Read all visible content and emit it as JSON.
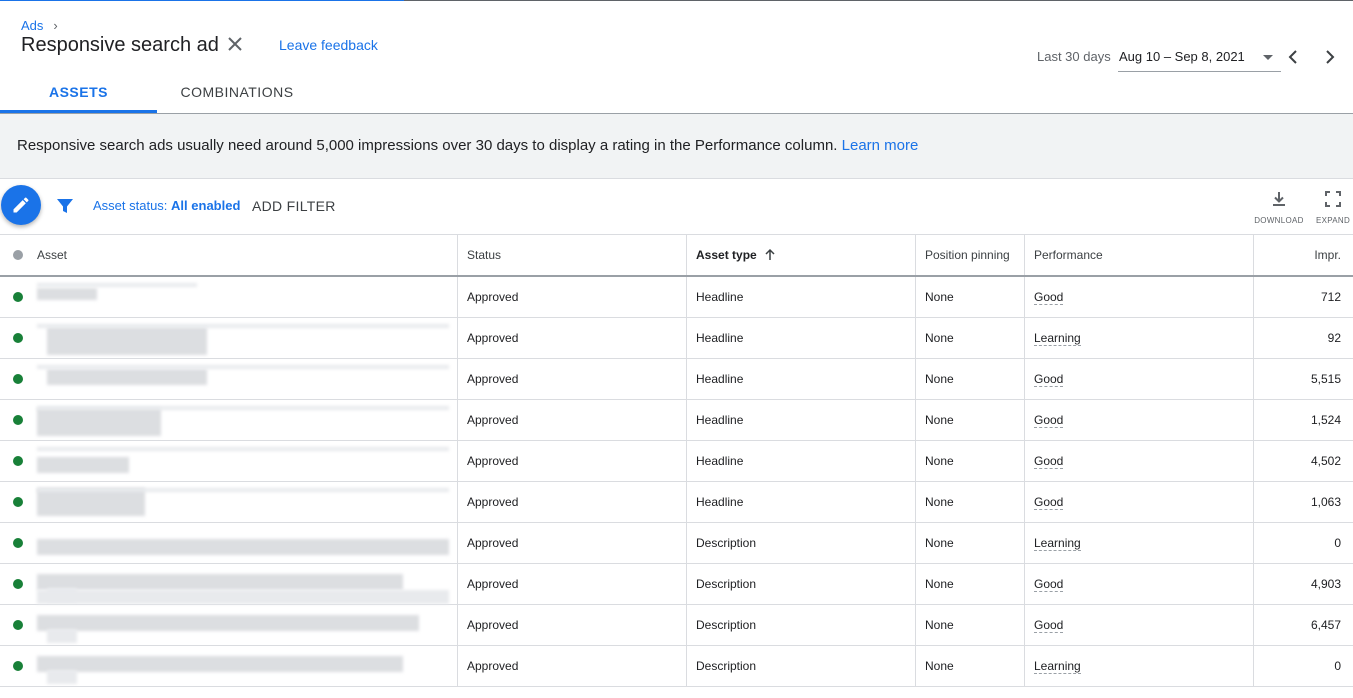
{
  "breadcrumb": {
    "parent": "Ads",
    "separator": "›"
  },
  "header": {
    "title": "Responsive search ad",
    "feedback_label": "Leave feedback",
    "date_range_label": "Last 30 days",
    "date_range_value": "Aug 10 – Sep 8, 2021"
  },
  "tabs": [
    {
      "label": "ASSETS",
      "active": true
    },
    {
      "label": "COMBINATIONS",
      "active": false
    }
  ],
  "banner": {
    "text": "Responsive search ads usually need around 5,000 impressions over 30 days to display a rating in the Performance column.",
    "link": "Learn more"
  },
  "toolbar": {
    "filter_prefix": "Asset status:",
    "filter_value": "All enabled",
    "add_filter": "ADD FILTER",
    "download": "DOWNLOAD",
    "expand": "EXPAND"
  },
  "table": {
    "columns": {
      "asset": "Asset",
      "status": "Status",
      "asset_type": "Asset type",
      "position_pinning": "Position pinning",
      "performance": "Performance",
      "impr": "Impr."
    },
    "sorted_by": "asset_type",
    "rows": [
      {
        "status": "Approved",
        "asset_type": "Headline",
        "pinning": "None",
        "performance": "Good",
        "impr": "712"
      },
      {
        "status": "Approved",
        "asset_type": "Headline",
        "pinning": "None",
        "performance": "Learning",
        "impr": "92"
      },
      {
        "status": "Approved",
        "asset_type": "Headline",
        "pinning": "None",
        "performance": "Good",
        "impr": "5,515"
      },
      {
        "status": "Approved",
        "asset_type": "Headline",
        "pinning": "None",
        "performance": "Good",
        "impr": "1,524"
      },
      {
        "status": "Approved",
        "asset_type": "Headline",
        "pinning": "None",
        "performance": "Good",
        "impr": "4,502"
      },
      {
        "status": "Approved",
        "asset_type": "Headline",
        "pinning": "None",
        "performance": "Good",
        "impr": "1,063"
      },
      {
        "status": "Approved",
        "asset_type": "Description",
        "pinning": "None",
        "performance": "Learning",
        "impr": "0"
      },
      {
        "status": "Approved",
        "asset_type": "Description",
        "pinning": "None",
        "performance": "Good",
        "impr": "4,903"
      },
      {
        "status": "Approved",
        "asset_type": "Description",
        "pinning": "None",
        "performance": "Good",
        "impr": "6,457"
      },
      {
        "status": "Approved",
        "asset_type": "Description",
        "pinning": "None",
        "performance": "Learning",
        "impr": "0"
      }
    ]
  },
  "colors": {
    "accent": "#1a73e8",
    "status_ok": "#188038"
  }
}
